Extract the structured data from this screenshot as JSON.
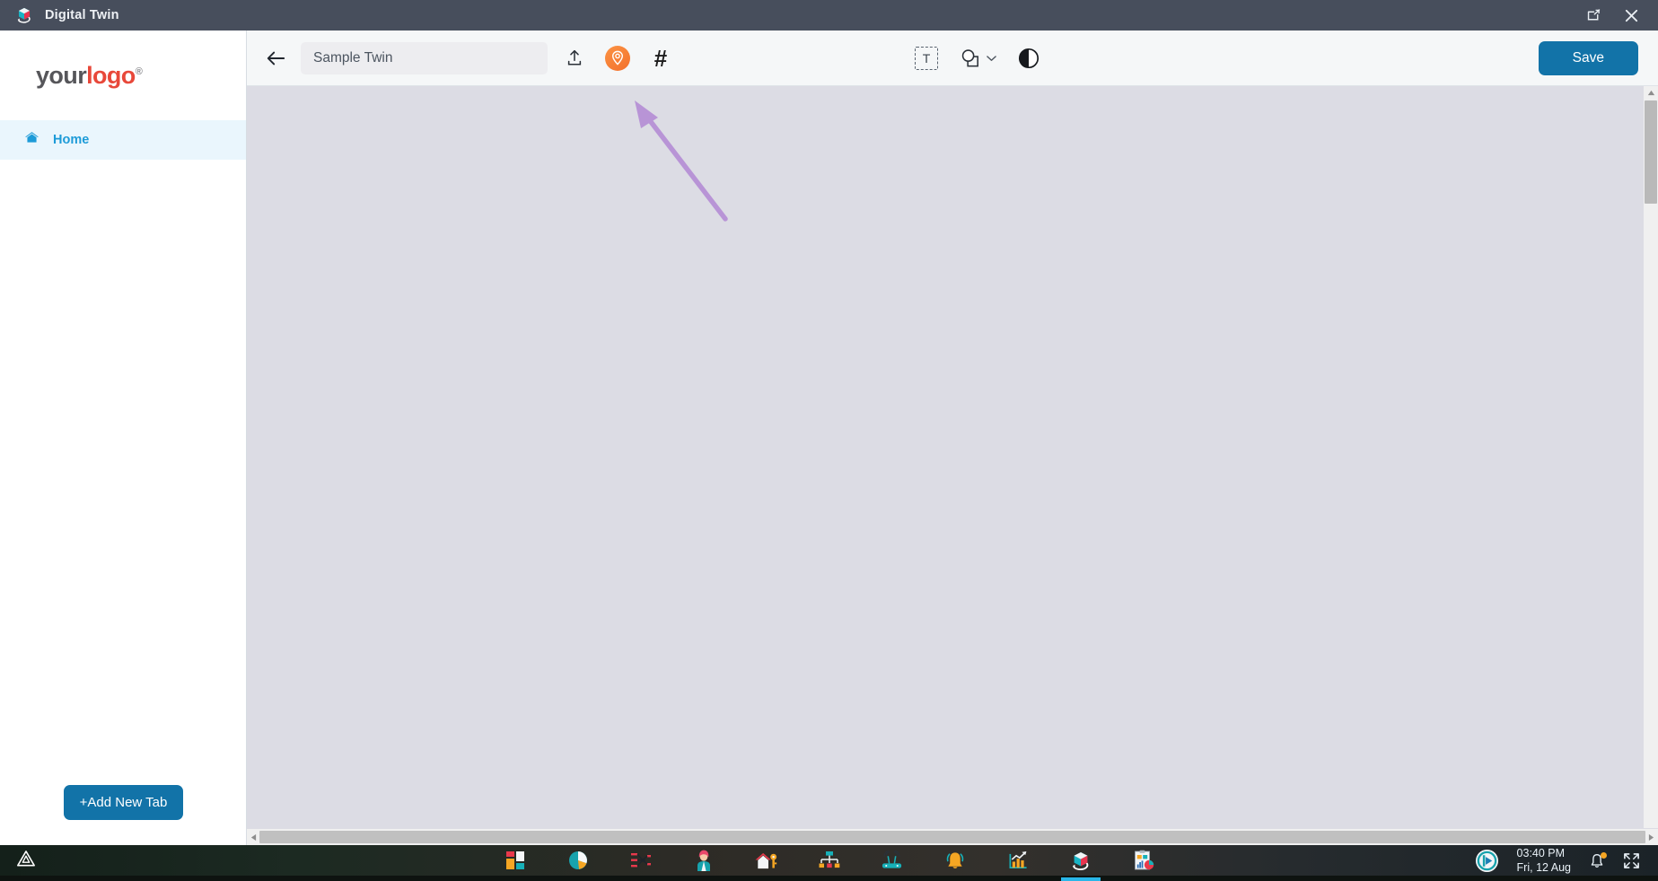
{
  "titlebar": {
    "app_name": "Digital Twin",
    "logo_icon": "digital-twin-cube-icon",
    "restore_icon": "restore-window-icon",
    "close_icon": "close-window-icon",
    "background": "#474e5c"
  },
  "sidebar": {
    "logo": {
      "part1": "your",
      "part2": "logo",
      "registered": "®",
      "color1": "#56565a",
      "color2": "#e8483a"
    },
    "items": [
      {
        "label": "Home",
        "icon": "home-icon",
        "active": true,
        "color": "#1d9bd8"
      }
    ],
    "add_tab_label": "+Add New Tab",
    "add_tab_color": "#1273a8"
  },
  "toolbar": {
    "back_icon": "back-arrow-icon",
    "twin_name_value": "Sample Twin",
    "twin_name_placeholder": "Sample Twin",
    "upload_icon": "upload-icon",
    "location_icon": "location-pin-icon",
    "location_color": "#f3702c",
    "hash_icon": "hash-grid-icon",
    "hash_glyph": "#",
    "text_tool_icon": "text-tool-icon",
    "text_tool_glyph": "T",
    "shape_tool_icon": "shape-tool-icon",
    "shape_dropdown_icon": "chevron-down-icon",
    "contrast_icon": "contrast-toggle-icon",
    "save_label": "Save",
    "save_color": "#1273a8"
  },
  "canvas": {
    "background": "#dcdce4",
    "annotation": {
      "type": "arrow",
      "color": "#b894d6",
      "points_to": "hash-grid-icon"
    }
  },
  "scrollbars": {
    "vertical_thumb_icon": "vertical-scroll-thumb",
    "horizontal_thumb_icon": "horizontal-scroll-thumb",
    "up_arrow_icon": "scroll-up-arrow-icon",
    "left_arrow_icon": "scroll-left-arrow-icon",
    "right_arrow_icon": "scroll-right-arrow-icon"
  },
  "taskbar": {
    "warning_icon": "warning-triangle-icon",
    "apps": [
      {
        "icon": "tiles-dashboard-icon",
        "active": false
      },
      {
        "icon": "pie-chart-icon",
        "active": false
      },
      {
        "icon": "flow-branch-icon",
        "active": false
      },
      {
        "icon": "person-avatar-icon",
        "active": false
      },
      {
        "icon": "home-key-icon",
        "active": false
      },
      {
        "icon": "hierarchy-chart-icon",
        "active": false
      },
      {
        "icon": "wifi-router-icon",
        "active": false
      },
      {
        "icon": "bell-alert-icon",
        "active": false
      },
      {
        "icon": "growth-chart-icon",
        "active": false
      },
      {
        "icon": "digital-twin-cube-icon",
        "active": true
      },
      {
        "icon": "report-dashboard-icon",
        "active": false
      }
    ],
    "launcher_icon": "launcher-play-icon",
    "time": "03:40 PM",
    "date": "Fri, 12 Aug",
    "notification_icon": "bell-icon",
    "notification_dot_color": "#f5a623",
    "fullscreen_icon": "expand-fullscreen-icon"
  }
}
